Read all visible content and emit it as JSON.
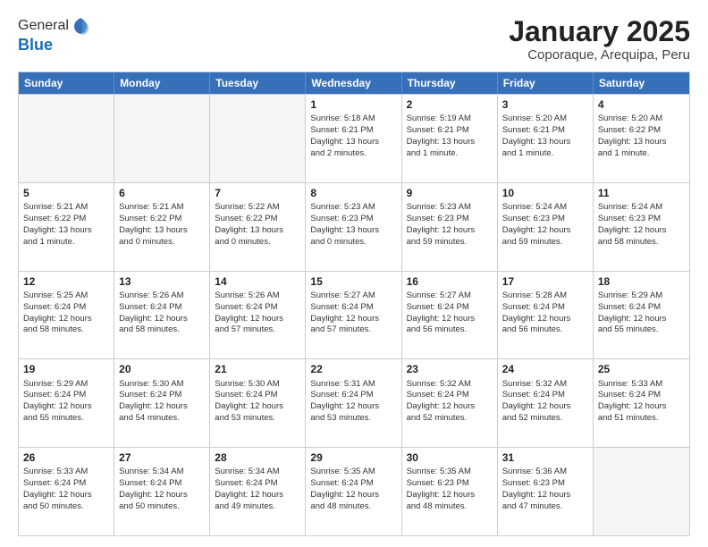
{
  "header": {
    "logo_general": "General",
    "logo_blue": "Blue",
    "month_title": "January 2025",
    "location": "Coporaque, Arequipa, Peru"
  },
  "days_of_week": [
    "Sunday",
    "Monday",
    "Tuesday",
    "Wednesday",
    "Thursday",
    "Friday",
    "Saturday"
  ],
  "weeks": [
    [
      {
        "day": "",
        "empty": true,
        "lines": []
      },
      {
        "day": "",
        "empty": true,
        "lines": []
      },
      {
        "day": "",
        "empty": true,
        "lines": []
      },
      {
        "day": "1",
        "empty": false,
        "lines": [
          "Sunrise: 5:18 AM",
          "Sunset: 6:21 PM",
          "Daylight: 13 hours",
          "and 2 minutes."
        ]
      },
      {
        "day": "2",
        "empty": false,
        "lines": [
          "Sunrise: 5:19 AM",
          "Sunset: 6:21 PM",
          "Daylight: 13 hours",
          "and 1 minute."
        ]
      },
      {
        "day": "3",
        "empty": false,
        "lines": [
          "Sunrise: 5:20 AM",
          "Sunset: 6:21 PM",
          "Daylight: 13 hours",
          "and 1 minute."
        ]
      },
      {
        "day": "4",
        "empty": false,
        "lines": [
          "Sunrise: 5:20 AM",
          "Sunset: 6:22 PM",
          "Daylight: 13 hours",
          "and 1 minute."
        ]
      }
    ],
    [
      {
        "day": "5",
        "empty": false,
        "lines": [
          "Sunrise: 5:21 AM",
          "Sunset: 6:22 PM",
          "Daylight: 13 hours",
          "and 1 minute."
        ]
      },
      {
        "day": "6",
        "empty": false,
        "lines": [
          "Sunrise: 5:21 AM",
          "Sunset: 6:22 PM",
          "Daylight: 13 hours",
          "and 0 minutes."
        ]
      },
      {
        "day": "7",
        "empty": false,
        "lines": [
          "Sunrise: 5:22 AM",
          "Sunset: 6:22 PM",
          "Daylight: 13 hours",
          "and 0 minutes."
        ]
      },
      {
        "day": "8",
        "empty": false,
        "lines": [
          "Sunrise: 5:23 AM",
          "Sunset: 6:23 PM",
          "Daylight: 13 hours",
          "and 0 minutes."
        ]
      },
      {
        "day": "9",
        "empty": false,
        "lines": [
          "Sunrise: 5:23 AM",
          "Sunset: 6:23 PM",
          "Daylight: 12 hours",
          "and 59 minutes."
        ]
      },
      {
        "day": "10",
        "empty": false,
        "lines": [
          "Sunrise: 5:24 AM",
          "Sunset: 6:23 PM",
          "Daylight: 12 hours",
          "and 59 minutes."
        ]
      },
      {
        "day": "11",
        "empty": false,
        "lines": [
          "Sunrise: 5:24 AM",
          "Sunset: 6:23 PM",
          "Daylight: 12 hours",
          "and 58 minutes."
        ]
      }
    ],
    [
      {
        "day": "12",
        "empty": false,
        "lines": [
          "Sunrise: 5:25 AM",
          "Sunset: 6:24 PM",
          "Daylight: 12 hours",
          "and 58 minutes."
        ]
      },
      {
        "day": "13",
        "empty": false,
        "lines": [
          "Sunrise: 5:26 AM",
          "Sunset: 6:24 PM",
          "Daylight: 12 hours",
          "and 58 minutes."
        ]
      },
      {
        "day": "14",
        "empty": false,
        "lines": [
          "Sunrise: 5:26 AM",
          "Sunset: 6:24 PM",
          "Daylight: 12 hours",
          "and 57 minutes."
        ]
      },
      {
        "day": "15",
        "empty": false,
        "lines": [
          "Sunrise: 5:27 AM",
          "Sunset: 6:24 PM",
          "Daylight: 12 hours",
          "and 57 minutes."
        ]
      },
      {
        "day": "16",
        "empty": false,
        "lines": [
          "Sunrise: 5:27 AM",
          "Sunset: 6:24 PM",
          "Daylight: 12 hours",
          "and 56 minutes."
        ]
      },
      {
        "day": "17",
        "empty": false,
        "lines": [
          "Sunrise: 5:28 AM",
          "Sunset: 6:24 PM",
          "Daylight: 12 hours",
          "and 56 minutes."
        ]
      },
      {
        "day": "18",
        "empty": false,
        "lines": [
          "Sunrise: 5:29 AM",
          "Sunset: 6:24 PM",
          "Daylight: 12 hours",
          "and 55 minutes."
        ]
      }
    ],
    [
      {
        "day": "19",
        "empty": false,
        "lines": [
          "Sunrise: 5:29 AM",
          "Sunset: 6:24 PM",
          "Daylight: 12 hours",
          "and 55 minutes."
        ]
      },
      {
        "day": "20",
        "empty": false,
        "lines": [
          "Sunrise: 5:30 AM",
          "Sunset: 6:24 PM",
          "Daylight: 12 hours",
          "and 54 minutes."
        ]
      },
      {
        "day": "21",
        "empty": false,
        "lines": [
          "Sunrise: 5:30 AM",
          "Sunset: 6:24 PM",
          "Daylight: 12 hours",
          "and 53 minutes."
        ]
      },
      {
        "day": "22",
        "empty": false,
        "lines": [
          "Sunrise: 5:31 AM",
          "Sunset: 6:24 PM",
          "Daylight: 12 hours",
          "and 53 minutes."
        ]
      },
      {
        "day": "23",
        "empty": false,
        "lines": [
          "Sunrise: 5:32 AM",
          "Sunset: 6:24 PM",
          "Daylight: 12 hours",
          "and 52 minutes."
        ]
      },
      {
        "day": "24",
        "empty": false,
        "lines": [
          "Sunrise: 5:32 AM",
          "Sunset: 6:24 PM",
          "Daylight: 12 hours",
          "and 52 minutes."
        ]
      },
      {
        "day": "25",
        "empty": false,
        "lines": [
          "Sunrise: 5:33 AM",
          "Sunset: 6:24 PM",
          "Daylight: 12 hours",
          "and 51 minutes."
        ]
      }
    ],
    [
      {
        "day": "26",
        "empty": false,
        "lines": [
          "Sunrise: 5:33 AM",
          "Sunset: 6:24 PM",
          "Daylight: 12 hours",
          "and 50 minutes."
        ]
      },
      {
        "day": "27",
        "empty": false,
        "lines": [
          "Sunrise: 5:34 AM",
          "Sunset: 6:24 PM",
          "Daylight: 12 hours",
          "and 50 minutes."
        ]
      },
      {
        "day": "28",
        "empty": false,
        "lines": [
          "Sunrise: 5:34 AM",
          "Sunset: 6:24 PM",
          "Daylight: 12 hours",
          "and 49 minutes."
        ]
      },
      {
        "day": "29",
        "empty": false,
        "lines": [
          "Sunrise: 5:35 AM",
          "Sunset: 6:24 PM",
          "Daylight: 12 hours",
          "and 48 minutes."
        ]
      },
      {
        "day": "30",
        "empty": false,
        "lines": [
          "Sunrise: 5:35 AM",
          "Sunset: 6:23 PM",
          "Daylight: 12 hours",
          "and 48 minutes."
        ]
      },
      {
        "day": "31",
        "empty": false,
        "lines": [
          "Sunrise: 5:36 AM",
          "Sunset: 6:23 PM",
          "Daylight: 12 hours",
          "and 47 minutes."
        ]
      },
      {
        "day": "",
        "empty": true,
        "lines": []
      }
    ]
  ]
}
